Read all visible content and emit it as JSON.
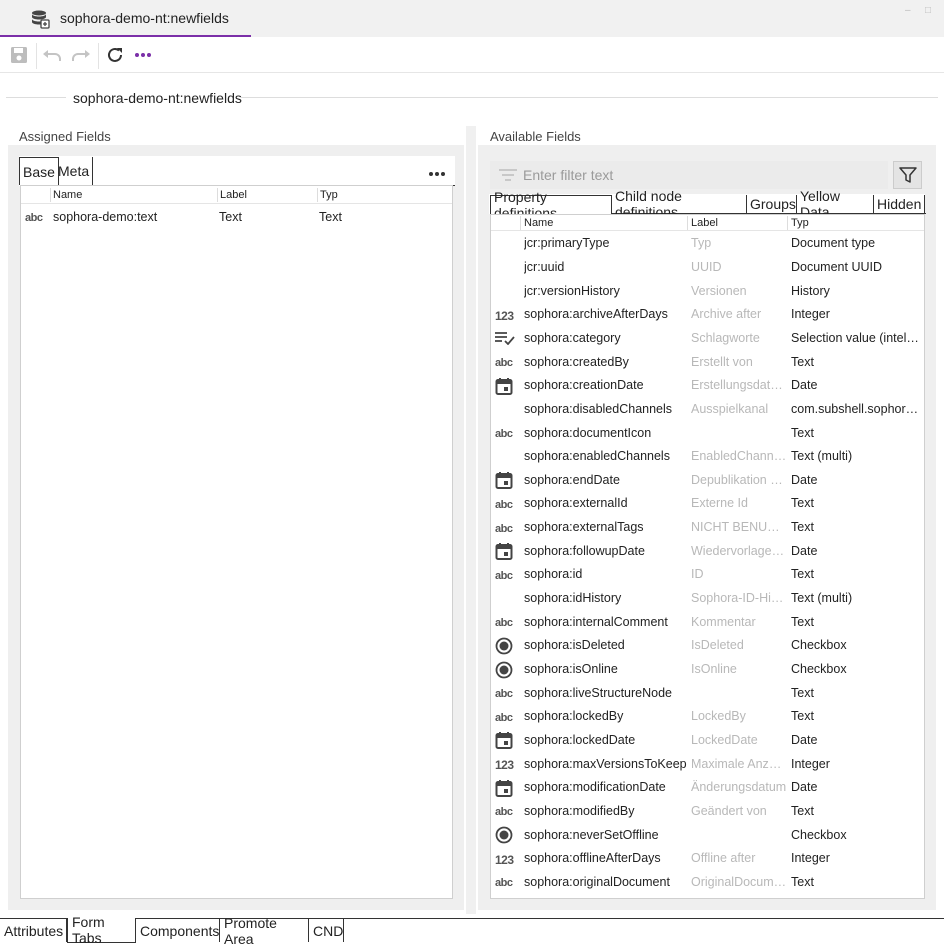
{
  "window": {
    "title": "sophora-demo-nt:newfields"
  },
  "header": {
    "doc_name": "sophora-demo-nt:newfields"
  },
  "assigned": {
    "title": "Assigned Fields",
    "tabs": [
      "Base",
      "Meta"
    ],
    "columns": [
      "Name",
      "Label",
      "Typ"
    ],
    "rows": [
      {
        "icon": "abc",
        "name": "sophora-demo:text",
        "label": "Text",
        "type": "Text"
      }
    ]
  },
  "available": {
    "title": "Available Fields",
    "filter_placeholder": "Enter filter text",
    "tabs": [
      "Property definitions",
      "Child node definitions",
      "Groups",
      "Yellow Data",
      "Hidden"
    ],
    "columns": [
      "Name",
      "Label",
      "Typ"
    ],
    "rows": [
      {
        "icon": "",
        "name": "jcr:primaryType",
        "label": "Typ",
        "type": "Document type"
      },
      {
        "icon": "",
        "name": "jcr:uuid",
        "label": "UUID",
        "type": "Document UUID"
      },
      {
        "icon": "",
        "name": "jcr:versionHistory",
        "label": "Versionen",
        "type": "History"
      },
      {
        "icon": "123",
        "name": "sophora:archiveAfterDays",
        "label": "Archive after",
        "type": "Integer"
      },
      {
        "icon": "list-check",
        "name": "sophora:category",
        "label": "Schlagworte",
        "type": "Selection value (intelli…"
      },
      {
        "icon": "abc",
        "name": "sophora:createdBy",
        "label": "Erstellt von",
        "type": "Text"
      },
      {
        "icon": "calendar",
        "name": "sophora:creationDate",
        "label": "Erstellungsdatum",
        "type": "Date"
      },
      {
        "icon": "",
        "name": "sophora:disabledChannels",
        "label": "Ausspielkanal",
        "type": "com.subshell.sophor…"
      },
      {
        "icon": "abc",
        "name": "sophora:documentIcon",
        "label": "",
        "type": "Text"
      },
      {
        "icon": "",
        "name": "sophora:enabledChannels",
        "label": "EnabledChannels",
        "type": "Text (multi)"
      },
      {
        "icon": "calendar",
        "name": "sophora:endDate",
        "label": "Depublikation am",
        "type": "Date"
      },
      {
        "icon": "abc",
        "name": "sophora:externalId",
        "label": "Externe Id",
        "type": "Text"
      },
      {
        "icon": "abc",
        "name": "sophora:externalTags",
        "label": "NICHT BENUTZ…",
        "type": "Text"
      },
      {
        "icon": "calendar",
        "name": "sophora:followupDate",
        "label": "Wiedervorlage am",
        "type": "Date"
      },
      {
        "icon": "abc",
        "name": "sophora:id",
        "label": "ID",
        "type": "Text"
      },
      {
        "icon": "",
        "name": "sophora:idHistory",
        "label": "Sophora-ID-Hist…",
        "type": "Text (multi)"
      },
      {
        "icon": "abc",
        "name": "sophora:internalComment",
        "label": "Kommentar",
        "type": "Text"
      },
      {
        "icon": "radio",
        "name": "sophora:isDeleted",
        "label": "IsDeleted",
        "type": "Checkbox"
      },
      {
        "icon": "radio",
        "name": "sophora:isOnline",
        "label": "IsOnline",
        "type": "Checkbox"
      },
      {
        "icon": "abc",
        "name": "sophora:liveStructureNode",
        "label": "",
        "type": "Text"
      },
      {
        "icon": "abc",
        "name": "sophora:lockedBy",
        "label": "LockedBy",
        "type": "Text"
      },
      {
        "icon": "calendar",
        "name": "sophora:lockedDate",
        "label": "LockedDate",
        "type": "Date"
      },
      {
        "icon": "123",
        "name": "sophora:maxVersionsToKeep",
        "label": "Maximale Anza…",
        "type": "Integer"
      },
      {
        "icon": "calendar",
        "name": "sophora:modificationDate",
        "label": "Änderungsdatum",
        "type": "Date"
      },
      {
        "icon": "abc",
        "name": "sophora:modifiedBy",
        "label": "Geändert von",
        "type": "Text"
      },
      {
        "icon": "radio",
        "name": "sophora:neverSetOffline",
        "label": "",
        "type": "Checkbox"
      },
      {
        "icon": "123",
        "name": "sophora:offlineAfterDays",
        "label": "Offline after",
        "type": "Integer"
      },
      {
        "icon": "abc",
        "name": "sophora:originalDocument",
        "label": "OriginalDocument",
        "type": "Text"
      }
    ]
  },
  "bottom_tabs": [
    "Attributes",
    "Form Tabs",
    "Components",
    "Promote Area",
    "CND"
  ],
  "active_bottom_tab": "Form Tabs",
  "colors": {
    "accent": "#7b2fa8",
    "label_gray": "#b8b8b8"
  }
}
